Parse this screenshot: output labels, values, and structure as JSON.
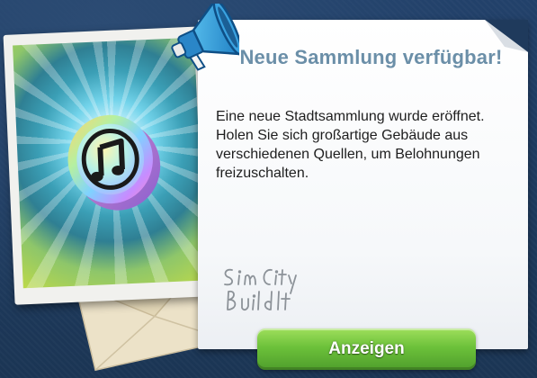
{
  "dialog": {
    "title": "Neue Sammlung verfügbar!",
    "message": "Eine neue Stadtsammlung wurde eröffnet. Holen Sie sich großartige Gebäude aus verschiedenen Quellen, um Belohnungen freizuschalten.",
    "primary_button_label": "Anzeigen"
  },
  "branding": {
    "signature_logo_text": "Sim City Build It"
  },
  "icons": {
    "collection": "music-note-coin-icon",
    "announcement": "megaphone-icon",
    "envelope": "envelope-icon"
  },
  "colors": {
    "background": "#1f3a5c",
    "title": "#6b8fa8",
    "button": "#6cc13a"
  }
}
